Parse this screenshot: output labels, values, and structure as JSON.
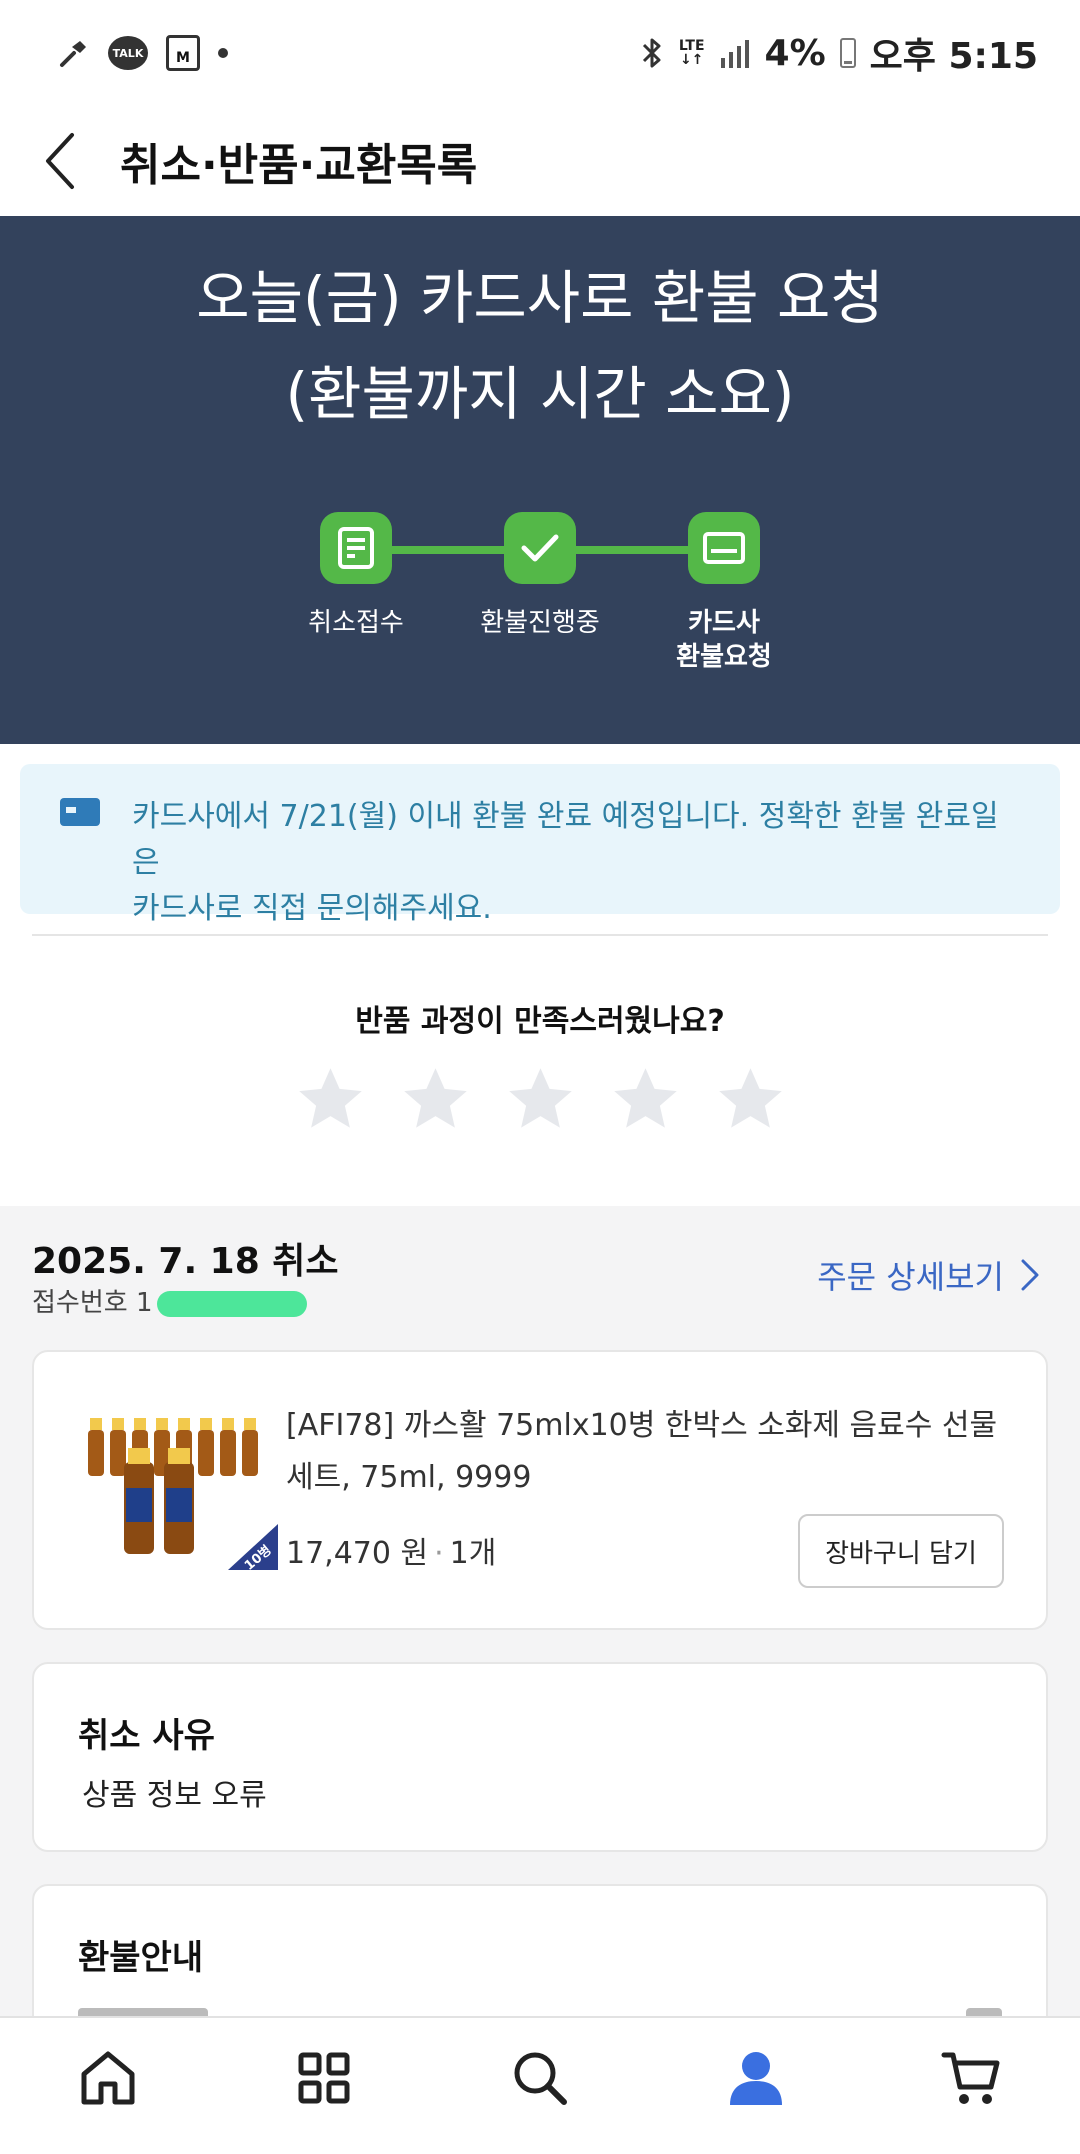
{
  "status_bar": {
    "talk_label": "TALK",
    "lock_label": "M",
    "network_label": "LTE",
    "battery_percent": "4%",
    "time": "오후 5:15"
  },
  "header": {
    "title": "취소·반품·교환목록"
  },
  "hero": {
    "title_line1": "오늘(금) 카드사로 환불 요청",
    "title_line2": "(환불까지 시간 소요)",
    "steps": [
      {
        "label": "취소접수",
        "icon": "document-icon"
      },
      {
        "label": "환불진행중",
        "icon": "check-icon"
      },
      {
        "label_line1": "카드사",
        "label_line2": "환불요청",
        "icon": "card-icon",
        "current": true
      }
    ],
    "accent_color": "#54b848",
    "background_color": "#33425c"
  },
  "info": {
    "line1": "카드사에서 7/21(월) 이내 환불 완료 예정입니다. 정확한 환불 완료일은",
    "line2": "카드사로 직접 문의해주세요."
  },
  "survey": {
    "question": "반품 과정이 만족스러웠나요?",
    "rating": 0,
    "max_rating": 5
  },
  "order": {
    "date_label": "2025. 7. 18 취소",
    "receipt_label": "접수번호",
    "receipt_visible": "1",
    "detail_link": "주문 상세보기"
  },
  "product": {
    "name": "[AFI78] 까스활 75mlx10병 한박스 소화제 음료수 선물세트, 75ml, 9999",
    "price": "17,470 원",
    "quantity": "1개",
    "cart_button": "장바구니 담기",
    "image_badge": "10병"
  },
  "reason": {
    "heading": "취소 사유",
    "text": "상품 정보 오류"
  },
  "refund": {
    "heading": "환불안내"
  },
  "bottom_nav": {
    "items": [
      "home-icon",
      "categories-icon",
      "search-icon",
      "my-page-icon",
      "cart-icon"
    ],
    "active": "my-page-icon",
    "active_color": "#3a6fe0"
  }
}
